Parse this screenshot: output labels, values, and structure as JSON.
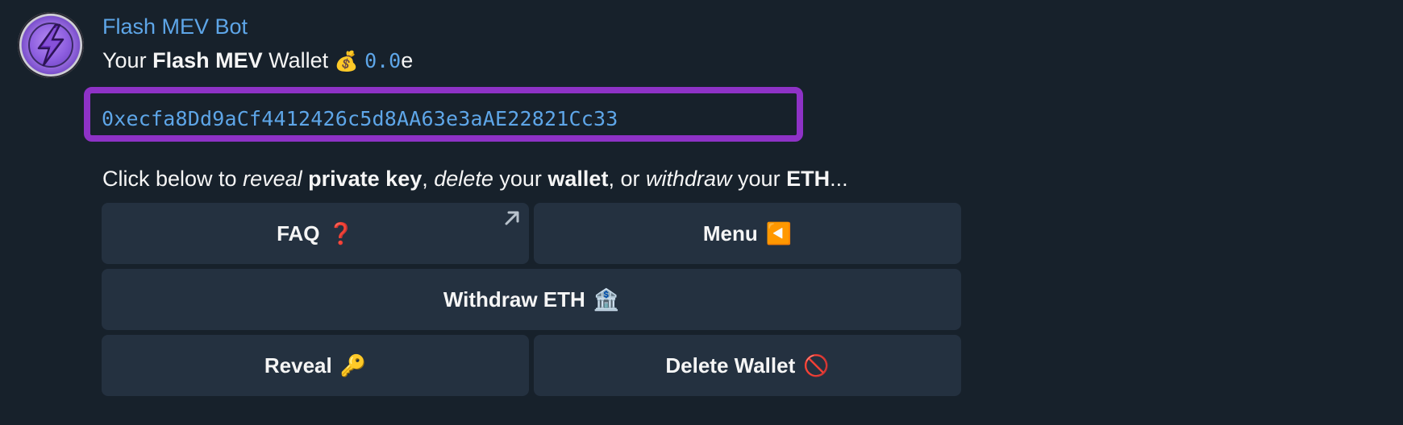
{
  "sender": {
    "name": "Flash MEV Bot"
  },
  "message": {
    "line1": {
      "prefix": "Your",
      "bold": "Flash MEV",
      "suffix": "Wallet",
      "bag_emoji": "💰",
      "balance": "0.0",
      "unit": "e"
    },
    "address": "0xecfa8Dd9aCf4412426c5d8AA63e3aAE22821Cc33",
    "line3": {
      "t1": "Click below to",
      "i1": "reveal",
      "b1": "private key",
      "t2": ",",
      "i2": "delete",
      "t3": "your",
      "b2": "wallet",
      "t4": ", or",
      "i3": "withdraw",
      "t5": "your",
      "b3": "ETH",
      "t6": "..."
    }
  },
  "keyboard": {
    "faq": {
      "label": "FAQ",
      "emoji": "❓"
    },
    "menu": {
      "label": "Menu",
      "emoji": "◀️"
    },
    "withdraw": {
      "label": "Withdraw ETH",
      "emoji": "🏦"
    },
    "reveal": {
      "label": "Reveal",
      "emoji": "🔑"
    },
    "delete": {
      "label": "Delete Wallet",
      "emoji": "🚫"
    }
  },
  "colors": {
    "background": "#17212b",
    "link": "#5ea6e8",
    "button": "#243140",
    "highlight": "#8e32c6"
  },
  "icons": {
    "avatar": "lightning-bolt-icon",
    "external_link": "arrow-up-right-icon"
  }
}
